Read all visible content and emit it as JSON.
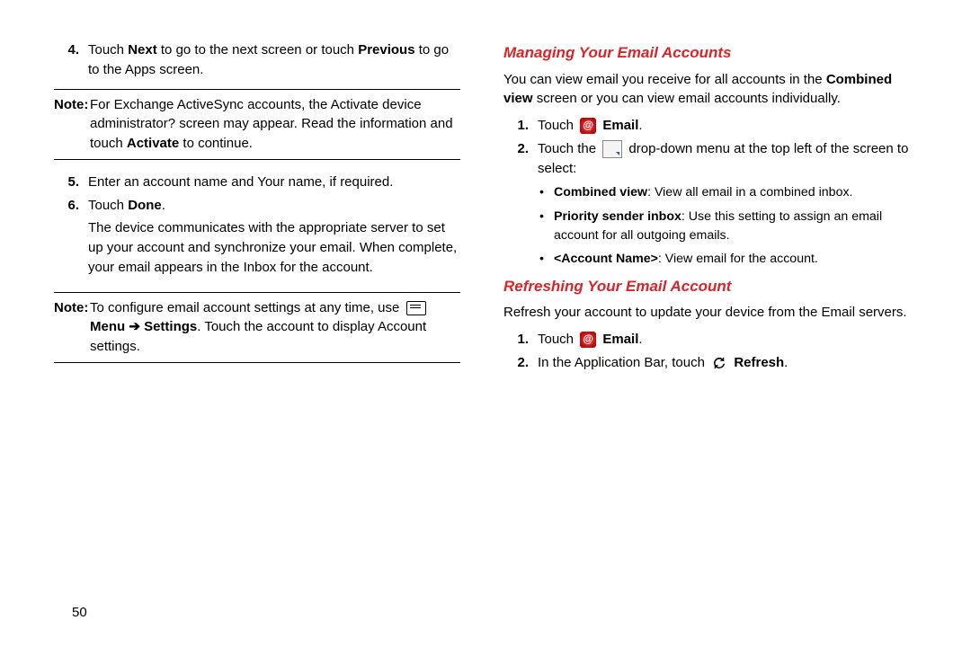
{
  "page_number": "50",
  "left": {
    "step4": {
      "num": "4.",
      "pre": "Touch ",
      "b1": "Next",
      "mid": " to go to the next screen or touch ",
      "b2": "Previous",
      "post": " to go to the Apps screen."
    },
    "note1": {
      "label": "Note:",
      "pre": "For Exchange ActiveSync accounts, the Activate device administrator? screen may appear. Read the information and touch ",
      "b1": "Activate",
      "post": " to continue."
    },
    "step5": {
      "num": "5.",
      "text": "Enter an account name and Your name, if required."
    },
    "step6": {
      "num": "6.",
      "pre": "Touch ",
      "b1": "Done",
      "post": ".",
      "desc": "The device communicates with the appropriate server to set up your account and synchronize your email. When complete, your email appears in the Inbox for the account."
    },
    "note2": {
      "label": "Note:",
      "pre": "To configure email account settings at any time, use ",
      "menu_b": "Menu",
      "arrow": " ➔ ",
      "settings_b": "Settings",
      "post": ". Touch the account to display Account settings."
    }
  },
  "right": {
    "h1": "Managing Your Email Accounts",
    "p1_pre": "You can view email you receive for all accounts in the ",
    "p1_b": "Combined view",
    "p1_post": " screen or you can view email accounts individually.",
    "m_step1": {
      "num": "1.",
      "pre": "Touch ",
      "b1": "Email",
      "post": "."
    },
    "m_step2": {
      "num": "2.",
      "pre": "Touch the ",
      "post": " drop-down menu at the top left of the screen to select:"
    },
    "bullets": {
      "b1": {
        "b": "Combined view",
        "t": ": View all email in a combined inbox."
      },
      "b2": {
        "b": "Priority sender inbox",
        "t": ": Use this setting to assign an email account for all outgoing emails."
      },
      "b3": {
        "b": "<Account Name>",
        "t": ": View email for the account."
      }
    },
    "h2": "Refreshing Your Email Account",
    "p2": "Refresh your account to update your device from the Email servers.",
    "r_step1": {
      "num": "1.",
      "pre": "Touch ",
      "b1": "Email",
      "post": "."
    },
    "r_step2": {
      "num": "2.",
      "pre": "In the Application Bar, touch ",
      "b1": "Refresh",
      "post": "."
    }
  }
}
